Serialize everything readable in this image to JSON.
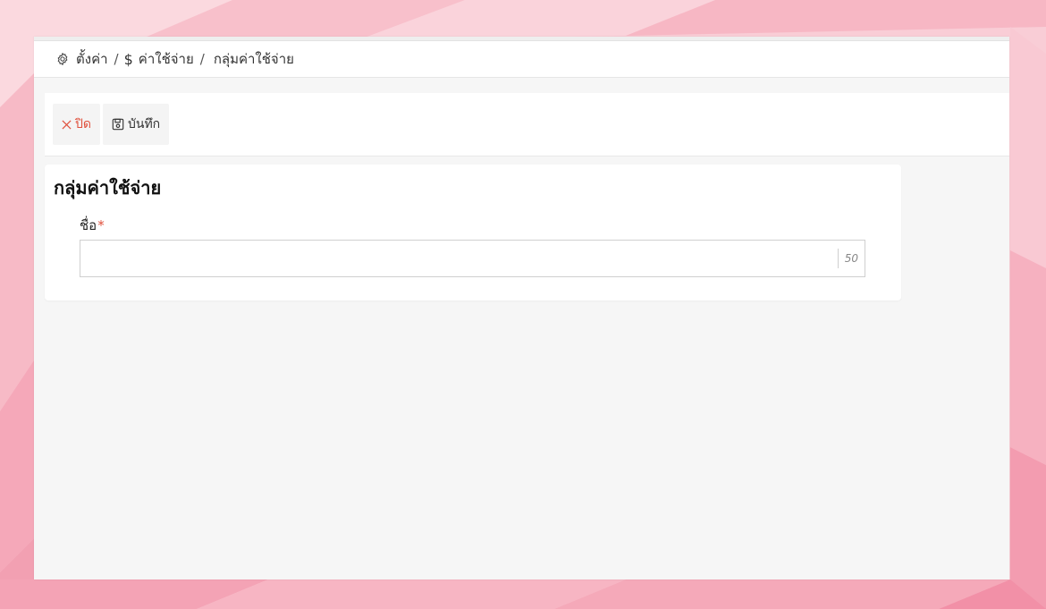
{
  "breadcrumb": {
    "items": [
      {
        "icon": "gear-icon",
        "label": "ตั้งค่า"
      },
      {
        "icon": "dollar-icon",
        "label": "ค่าใช้จ่าย"
      },
      {
        "icon": "",
        "label": "กลุ่มค่าใช้จ่าย"
      }
    ],
    "separator": "/"
  },
  "toolbar": {
    "close_label": "ปิด",
    "save_label": "บันทึก"
  },
  "form": {
    "title": "กลุ่มค่าใช้จ่าย",
    "name_label": "ชื่อ",
    "required_mark": "*",
    "name_value": "",
    "max_length": "50"
  },
  "colors": {
    "accent_red": "#e0503c",
    "panel_bg": "#f6f6f6",
    "background_pink": "#f8c6d0"
  }
}
